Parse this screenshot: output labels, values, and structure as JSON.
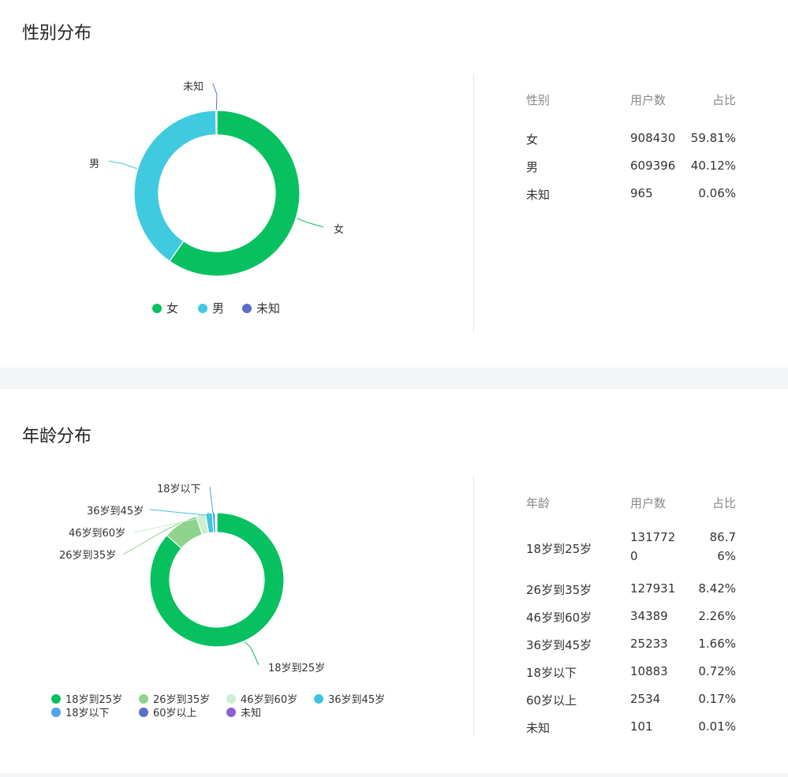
{
  "gender": {
    "title": "性别分布",
    "table": {
      "headers": [
        "性别",
        "用户数",
        "占比"
      ],
      "rows": [
        {
          "label": "女",
          "count": "908430",
          "pct": "59.81%"
        },
        {
          "label": "男",
          "count": "609396",
          "pct": "40.12%"
        },
        {
          "label": "未知",
          "count": "965",
          "pct": "0.06%"
        }
      ]
    }
  },
  "age": {
    "title": "年龄分布",
    "table": {
      "headers": [
        "年龄",
        "用户数",
        "占比"
      ],
      "rows": [
        {
          "label": "18岁到25岁",
          "count": "1317720",
          "pct": "86.76%"
        },
        {
          "label": "26岁到35岁",
          "count": "127931",
          "pct": "8.42%"
        },
        {
          "label": "46岁到60岁",
          "count": "34389",
          "pct": "2.26%"
        },
        {
          "label": "36岁到45岁",
          "count": "25233",
          "pct": "1.66%"
        },
        {
          "label": "18岁以下",
          "count": "10883",
          "pct": "0.72%"
        },
        {
          "label": "60岁以上",
          "count": "2534",
          "pct": "0.17%"
        },
        {
          "label": "未知",
          "count": "101",
          "pct": "0.01%"
        }
      ]
    }
  },
  "chart_data": [
    {
      "type": "pie",
      "title": "性别分布",
      "categories": [
        "女",
        "男",
        "未知"
      ],
      "values": [
        908430,
        609396,
        965
      ],
      "colors": [
        "#07c160",
        "#40cae0",
        "#5b6ec9"
      ],
      "legend": "bottom"
    },
    {
      "type": "pie",
      "title": "年龄分布",
      "categories": [
        "18岁到25岁",
        "26岁到35岁",
        "46岁到60岁",
        "36岁到45岁",
        "18岁以下",
        "60岁以上",
        "未知"
      ],
      "values": [
        1317720,
        127931,
        34389,
        25233,
        10883,
        2534,
        101
      ],
      "colors": [
        "#07c160",
        "#8ed48c",
        "#cdeed1",
        "#40c4e0",
        "#4fa3e8",
        "#5b6ec9",
        "#8a62d0"
      ],
      "legend": "bottom",
      "legend_order": [
        "18岁到25岁",
        "26岁到35岁",
        "46岁到60岁",
        "36岁到45岁",
        "18岁以下",
        "60岁以上",
        "未知"
      ]
    }
  ]
}
